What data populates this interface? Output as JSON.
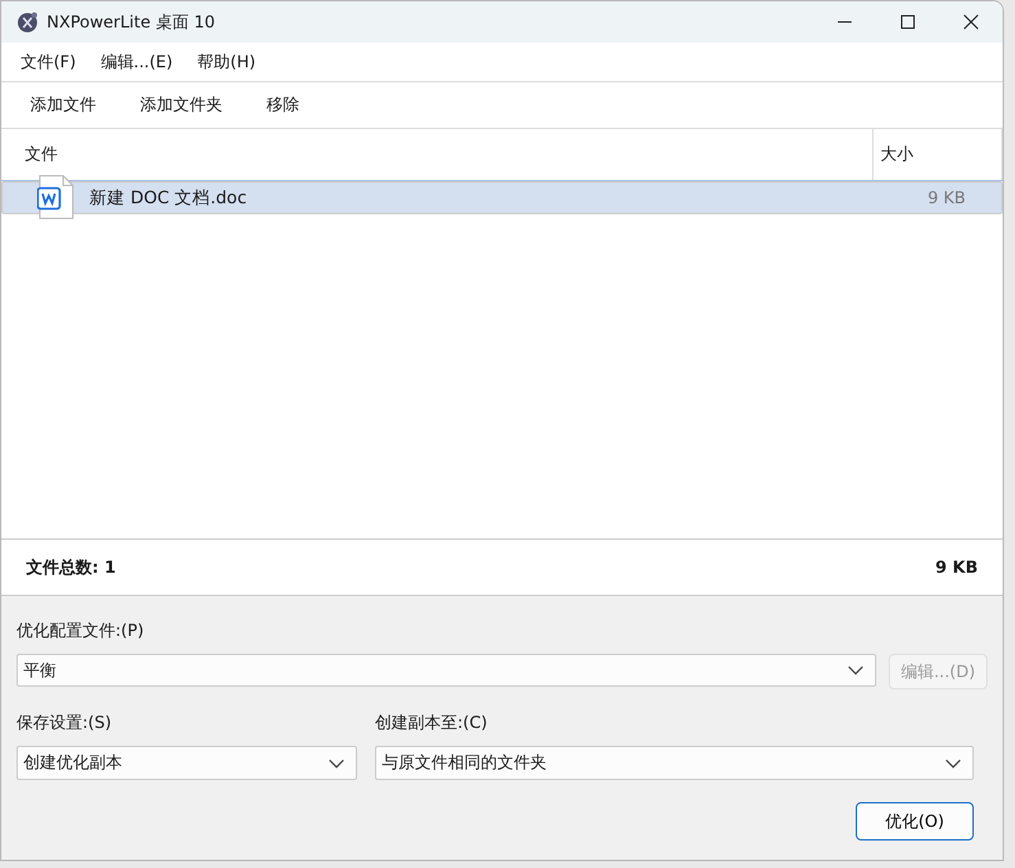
{
  "window": {
    "title": "NXPowerLite 桌面 10"
  },
  "menu": [
    "文件(F)",
    "编辑...(E)",
    "帮助(H)"
  ],
  "toolbar": [
    "添加文件",
    "添加文件夹",
    "移除"
  ],
  "table": {
    "columns": [
      "文件",
      "大小"
    ],
    "rows": [
      {
        "name": "新建 DOC 文档.doc",
        "size": "9 KB",
        "selected": true
      }
    ]
  },
  "summary": {
    "count": "文件总数: 1",
    "total": "9 KB"
  },
  "profile": {
    "label": "优化配置文件:(P)",
    "value": "平衡",
    "edit_button": {
      "label": "编辑...(D)",
      "disabled": true
    }
  },
  "save": {
    "label": "保存设置:(S)",
    "value": "创建优化副本"
  },
  "copy_to": {
    "label": "创建副本至:(C)",
    "value": "与原文件相同的文件夹"
  },
  "optimize_button": "优化(O)"
}
